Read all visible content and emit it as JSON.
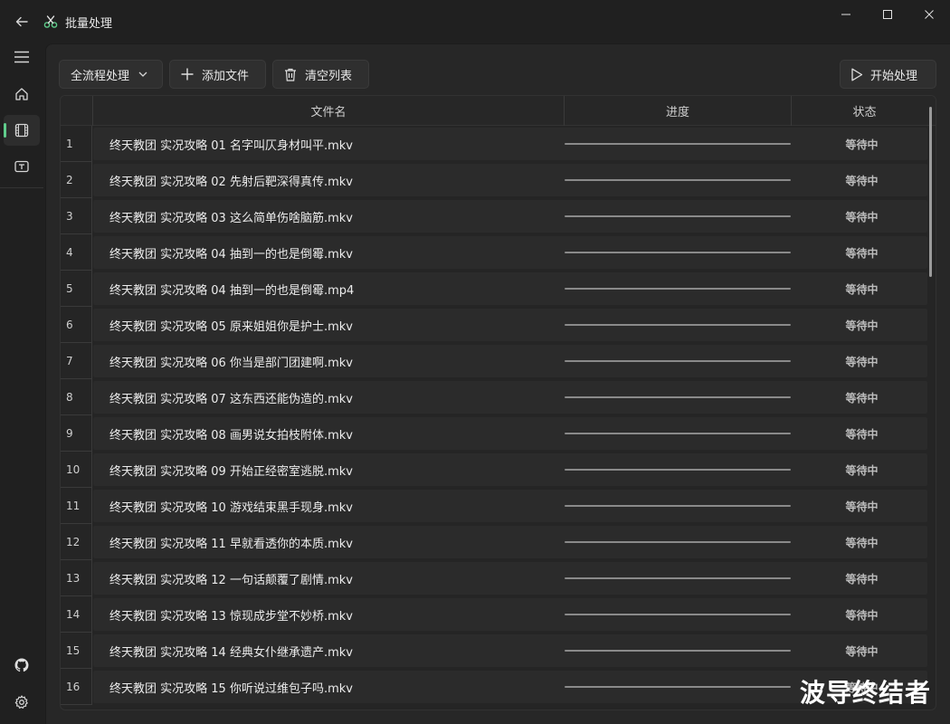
{
  "window": {
    "title": "批量处理"
  },
  "toolbar": {
    "mode_select": "全流程处理",
    "add_files": "添加文件",
    "clear_list": "清空列表",
    "start": "开始处理"
  },
  "table": {
    "headers": {
      "filename": "文件名",
      "progress": "进度",
      "status": "状态"
    },
    "rows": [
      {
        "index": "1",
        "filename": "终天教团 实况攻略 01 名字叫仄身材叫平.mkv",
        "progress": 0,
        "status": "等待中"
      },
      {
        "index": "2",
        "filename": "终天教团 实况攻略 02 先射后靶深得真传.mkv",
        "progress": 0,
        "status": "等待中"
      },
      {
        "index": "3",
        "filename": "终天教团 实况攻略 03 这么简单伤啥脑筋.mkv",
        "progress": 0,
        "status": "等待中"
      },
      {
        "index": "4",
        "filename": "终天教团 实况攻略 04 抽到一的也是倒霉.mkv",
        "progress": 0,
        "status": "等待中"
      },
      {
        "index": "5",
        "filename": "终天教团 实况攻略 04 抽到一的也是倒霉.mp4",
        "progress": 0,
        "status": "等待中"
      },
      {
        "index": "6",
        "filename": "终天教团 实况攻略 05 原来姐姐你是护士.mkv",
        "progress": 0,
        "status": "等待中"
      },
      {
        "index": "7",
        "filename": "终天教团 实况攻略 06 你当是部门团建啊.mkv",
        "progress": 0,
        "status": "等待中"
      },
      {
        "index": "8",
        "filename": "终天教团 实况攻略 07 这东西还能伪造的.mkv",
        "progress": 0,
        "status": "等待中"
      },
      {
        "index": "9",
        "filename": "终天教团 实况攻略 08 画男说女拍枝附体.mkv",
        "progress": 0,
        "status": "等待中"
      },
      {
        "index": "10",
        "filename": "终天教团 实况攻略 09 开始正经密室逃脱.mkv",
        "progress": 0,
        "status": "等待中"
      },
      {
        "index": "11",
        "filename": "终天教团 实况攻略 10 游戏结束黑手现身.mkv",
        "progress": 0,
        "status": "等待中"
      },
      {
        "index": "12",
        "filename": "终天教团 实况攻略 11 早就看透你的本质.mkv",
        "progress": 0,
        "status": "等待中"
      },
      {
        "index": "13",
        "filename": "终天教团 实况攻略 12 一句话颠覆了剧情.mkv",
        "progress": 0,
        "status": "等待中"
      },
      {
        "index": "14",
        "filename": "终天教团 实况攻略 13 惊现成步堂不妙桥.mkv",
        "progress": 0,
        "status": "等待中"
      },
      {
        "index": "15",
        "filename": "终天教团 实况攻略 14 经典女仆继承遗产.mkv",
        "progress": 0,
        "status": "等待中"
      },
      {
        "index": "16",
        "filename": "终天教团 实况攻略 15 你听说过维包子吗.mkv",
        "progress": 0,
        "status": "等待中"
      }
    ]
  },
  "watermark": "波导终结者",
  "colors": {
    "accent": "#60cd8c",
    "background": "#202020",
    "content": "#272727"
  }
}
